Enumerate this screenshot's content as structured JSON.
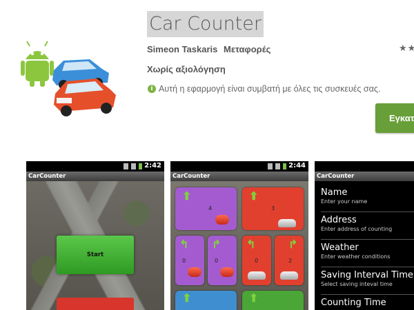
{
  "app": {
    "title": "Car Counter",
    "author": "Simeon Taskaris",
    "category": "Μεταφορές",
    "stars": "★★",
    "rating_text": "Χωρίς αξιολόγηση",
    "compat_text": "Αυτή η εφαρμογή είναι συμβατή με όλες τις συσκευές σας.",
    "install_label": "Εγκατάσταση",
    "accent_color": "#689f38"
  },
  "screens": [
    {
      "clock": "2:42",
      "app_name": "CarCounter",
      "start_label": "Start"
    },
    {
      "clock": "2:44",
      "app_name": "CarCounter",
      "tiles": [
        {
          "count": "4",
          "color": "#a45bd0"
        },
        {
          "count": "3",
          "color": "#e2402f"
        },
        {
          "count": "0",
          "color": "#a45bd0"
        },
        {
          "count": "0",
          "color": "#a45bd0"
        },
        {
          "count": "0",
          "color": "#e2402f"
        },
        {
          "count": "2",
          "color": "#e2402f"
        },
        {
          "count": "",
          "color": "#3f8fd0"
        },
        {
          "count": "",
          "color": "#4aa636"
        }
      ]
    },
    {
      "app_name": "CarCounter",
      "settings": [
        {
          "title": "Name",
          "sub": "Enter your name"
        },
        {
          "title": "Address",
          "sub": "Enter address of counting"
        },
        {
          "title": "Weather",
          "sub": "Enter weather conditions"
        },
        {
          "title": "Saving Interval Time",
          "sub": "Select saving inteval time"
        },
        {
          "title": "Counting Time",
          "sub": ""
        }
      ]
    }
  ]
}
